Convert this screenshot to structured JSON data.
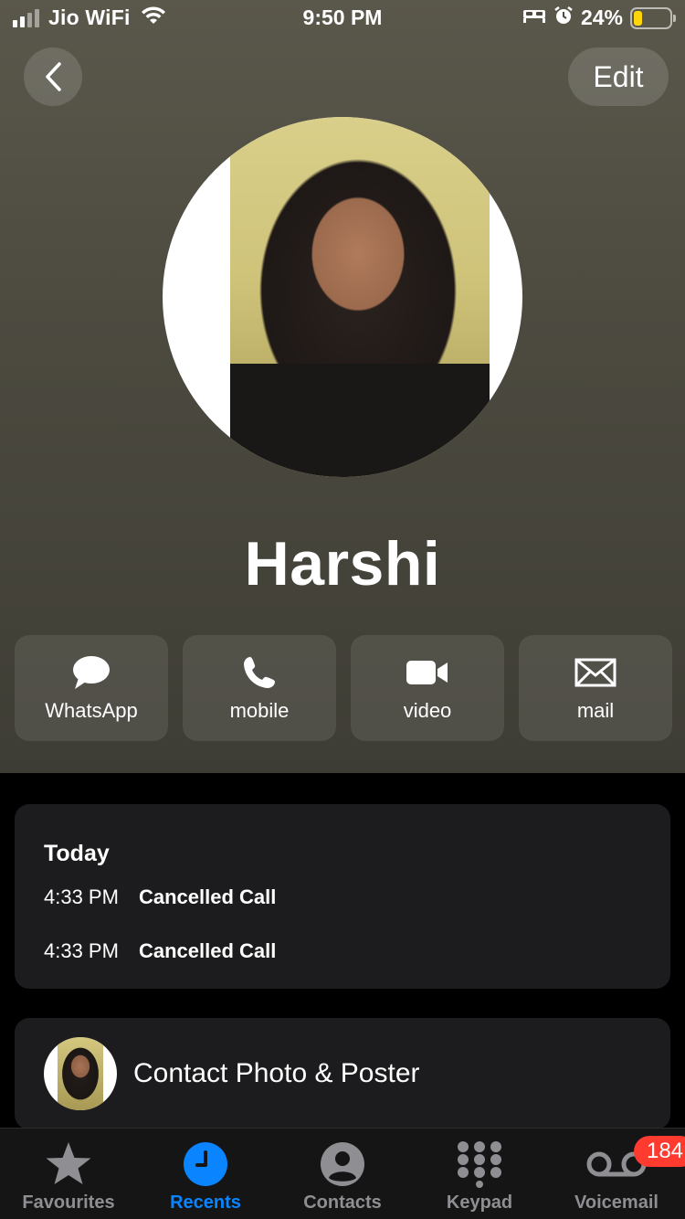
{
  "status_bar": {
    "carrier": "Jio WiFi",
    "time": "9:50 PM",
    "battery_percent": "24%",
    "battery_level": 0.24,
    "icons": [
      "signal-icon",
      "wifi-icon",
      "bed-icon",
      "alarm-icon",
      "battery-icon"
    ]
  },
  "nav": {
    "back_icon": "chevron-left-icon",
    "edit_label": "Edit"
  },
  "contact": {
    "name": "Harshi"
  },
  "actions": [
    {
      "label": "WhatsApp",
      "icon": "message-bubble-icon"
    },
    {
      "label": "mobile",
      "icon": "phone-icon"
    },
    {
      "label": "video",
      "icon": "video-camera-icon"
    },
    {
      "label": "mail",
      "icon": "envelope-icon"
    }
  ],
  "recents": {
    "title": "Today",
    "calls": [
      {
        "time": "4:33 PM",
        "status": "Cancelled Call"
      },
      {
        "time": "4:33 PM",
        "status": "Cancelled Call"
      }
    ]
  },
  "photo_poster": {
    "label": "Contact Photo & Poster"
  },
  "tab_bar": {
    "tabs": [
      {
        "label": "Favourites",
        "icon": "star-icon",
        "active": false
      },
      {
        "label": "Recents",
        "icon": "clock-icon",
        "active": true
      },
      {
        "label": "Contacts",
        "icon": "person-circle-icon",
        "active": false
      },
      {
        "label": "Keypad",
        "icon": "keypad-icon",
        "active": false
      },
      {
        "label": "Voicemail",
        "icon": "voicemail-icon",
        "active": false,
        "badge": "184"
      }
    ]
  },
  "colors": {
    "accent": "#0a84ff",
    "badge": "#ff3b30",
    "battery": "#ffd60a",
    "card_bg": "#1c1c1e"
  }
}
